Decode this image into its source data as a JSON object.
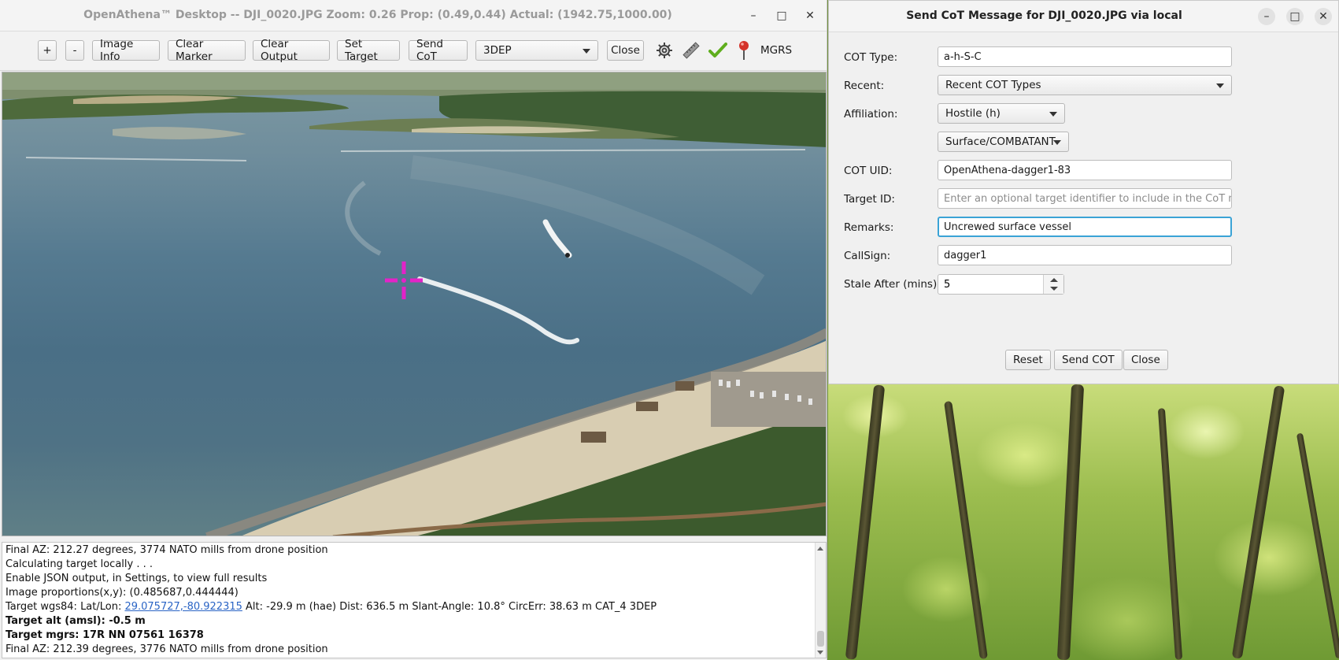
{
  "main_window": {
    "title": "OpenAthena™ Desktop -- DJI_0020.JPG Zoom: 0.26 Prop: (0.49,0.44) Actual: (1942.75,1000.00)",
    "controls": {
      "minimize": "–",
      "maximize": "□",
      "close": "✕"
    }
  },
  "toolbar": {
    "zoom_in": "+",
    "zoom_out": "-",
    "image_info": "Image Info",
    "clear_marker": "Clear Marker",
    "clear_output": "Clear Output",
    "set_target": "Set Target",
    "send_cot": "Send CoT",
    "dem_select": "3DEP",
    "close": "Close",
    "coord_format": "MGRS",
    "icons": [
      "gear-icon",
      "ruler-icon",
      "checkmark-icon",
      "map-pin-icon"
    ],
    "colors": {
      "checkmark": "#5fae1e",
      "pin": "#d4332a"
    }
  },
  "marker": {
    "color": "#e323c8"
  },
  "console": {
    "lines": [
      "Final AZ: 212.27 degrees, 3774 NATO mills from drone position",
      "Calculating target locally . . .",
      "Enable JSON output, in Settings, to view full results",
      "Image proportions(x,y): (0.485687,0.444444)"
    ],
    "target_prefix": "Target wgs84: Lat/Lon: ",
    "target_link": "29.075727,-80.922315",
    "target_suffix": "  Alt: -29.9 m (hae) Dist: 636.5 m  Slant-Angle: 10.8° CircErr: 38.63 m CAT_4 3DEP",
    "target_alt": "Target alt (amsl): -0.5 m",
    "target_mgrs": "Target mgrs: 17R NN 07561 16378",
    "last_line": "Final AZ: 212.39 degrees, 3776 NATO mills from drone position"
  },
  "cot_dialog": {
    "title": "Send CoT Message for DJI_0020.JPG via local",
    "labels": {
      "cot_type": "COT Type:",
      "recent": "Recent:",
      "affiliation": "Affiliation:",
      "cot_uid": "COT UID:",
      "target_id": "Target ID:",
      "remarks": "Remarks:",
      "callsign": "CallSign:",
      "stale_after": "Stale After (mins):"
    },
    "values": {
      "cot_type": "a-h-S-C",
      "recent": "Recent COT Types",
      "affiliation": "Hostile (h)",
      "dimension": "Surface/COMBATANT",
      "cot_uid": "OpenAthena-dagger1-83",
      "target_id_placeholder": "Enter an optional target identifier to include in the CoT message",
      "remarks": "Uncrewed surface vessel",
      "callsign": "dagger1",
      "stale_after": "5"
    },
    "buttons": {
      "reset": "Reset",
      "send": "Send COT",
      "close": "Close"
    }
  }
}
